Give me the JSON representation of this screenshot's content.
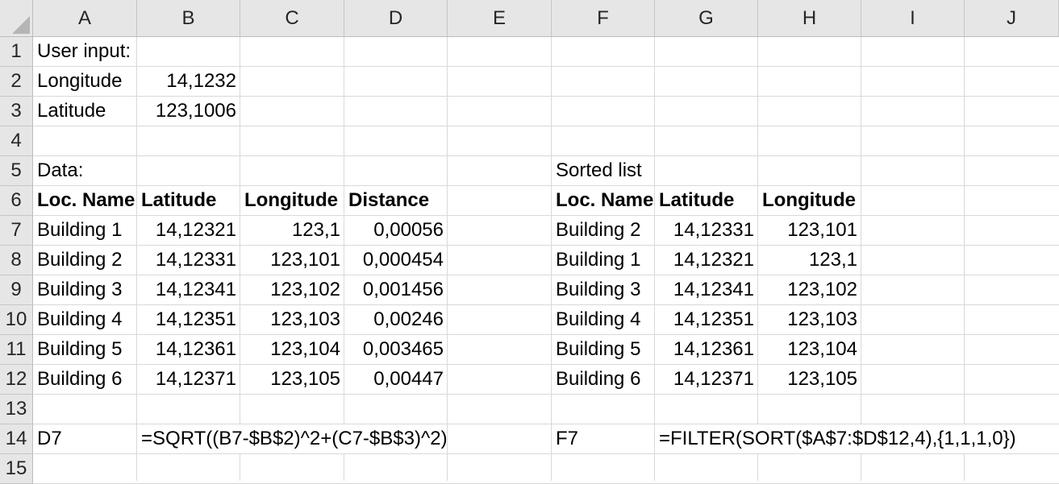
{
  "columns": [
    "A",
    "B",
    "C",
    "D",
    "E",
    "F",
    "G",
    "H",
    "I",
    "J"
  ],
  "rows": [
    "1",
    "2",
    "3",
    "4",
    "5",
    "6",
    "7",
    "8",
    "9",
    "10",
    "11",
    "12",
    "13",
    "14",
    "15"
  ],
  "cells": {
    "A1": "User input:",
    "A2": "Longitude",
    "B2": "14,1232",
    "A3": "Latitude",
    "B3": "123,1006",
    "A5": "Data:",
    "F5": "Sorted list",
    "A6": "Loc. Name",
    "B6": "Latitude",
    "C6": "Longitude",
    "D6": "Distance",
    "F6": "Loc. Name",
    "G6": "Latitude",
    "H6": "Longitude",
    "A7": "Building 1",
    "B7": "14,12321",
    "C7": "123,1",
    "D7": "0,00056",
    "A8": "Building 2",
    "B8": "14,12331",
    "C8": "123,101",
    "D8": "0,000454",
    "A9": "Building 3",
    "B9": "14,12341",
    "C9": "123,102",
    "D9": "0,001456",
    "A10": "Building 4",
    "B10": "14,12351",
    "C10": "123,103",
    "D10": "0,00246",
    "A11": "Building 5",
    "B11": "14,12361",
    "C11": "123,104",
    "D11": "0,003465",
    "A12": "Building 6",
    "B12": "14,12371",
    "C12": "123,105",
    "D12": "0,00447",
    "F7": "Building 2",
    "G7": "14,12331",
    "H7": "123,101",
    "F8": "Building 1",
    "G8": "14,12321",
    "H8": "123,1",
    "F9": "Building 3",
    "G9": "14,12341",
    "H9": "123,102",
    "F10": "Building 4",
    "G10": "14,12351",
    "H10": "123,103",
    "F11": "Building 5",
    "G11": "14,12361",
    "H11": "123,104",
    "F12": "Building 6",
    "G12": "14,12371",
    "H12": "123,105",
    "A14": "D7",
    "B14": "=SQRT((B7-$B$2)^2+(C7-$B$3)^2)",
    "F14": "F7",
    "G14": "=FILTER(SORT($A$7:$D$12,4),{1,1,1,0})"
  }
}
